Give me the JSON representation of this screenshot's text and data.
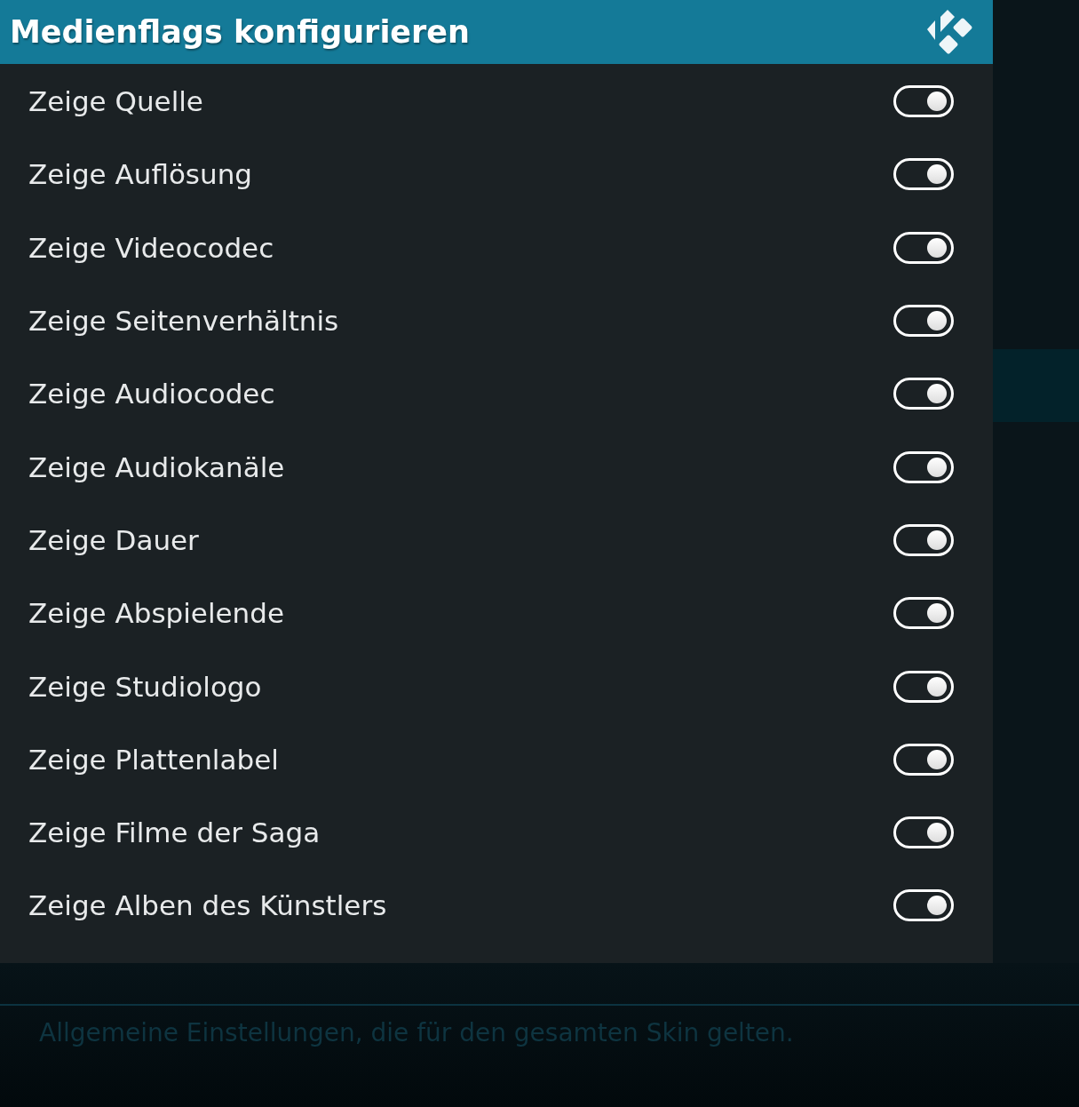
{
  "dialog": {
    "title": "Medienflags konfigurieren"
  },
  "settings": [
    {
      "label": "Zeige Quelle",
      "on": true
    },
    {
      "label": "Zeige Auflösung",
      "on": true
    },
    {
      "label": "Zeige Videocodec",
      "on": true
    },
    {
      "label": "Zeige Seitenverhältnis",
      "on": true
    },
    {
      "label": "Zeige Audiocodec",
      "on": true
    },
    {
      "label": "Zeige Audiokanäle",
      "on": true
    },
    {
      "label": "Zeige Dauer",
      "on": true
    },
    {
      "label": "Zeige Abspielende",
      "on": true
    },
    {
      "label": "Zeige Studiologo",
      "on": true
    },
    {
      "label": "Zeige Plattenlabel",
      "on": true
    },
    {
      "label": "Zeige Filme der Saga",
      "on": true
    },
    {
      "label": "Zeige Alben des Künstlers",
      "on": true
    }
  ],
  "description": "Allgemeine Einstellungen, die für den gesamten Skin gelten."
}
